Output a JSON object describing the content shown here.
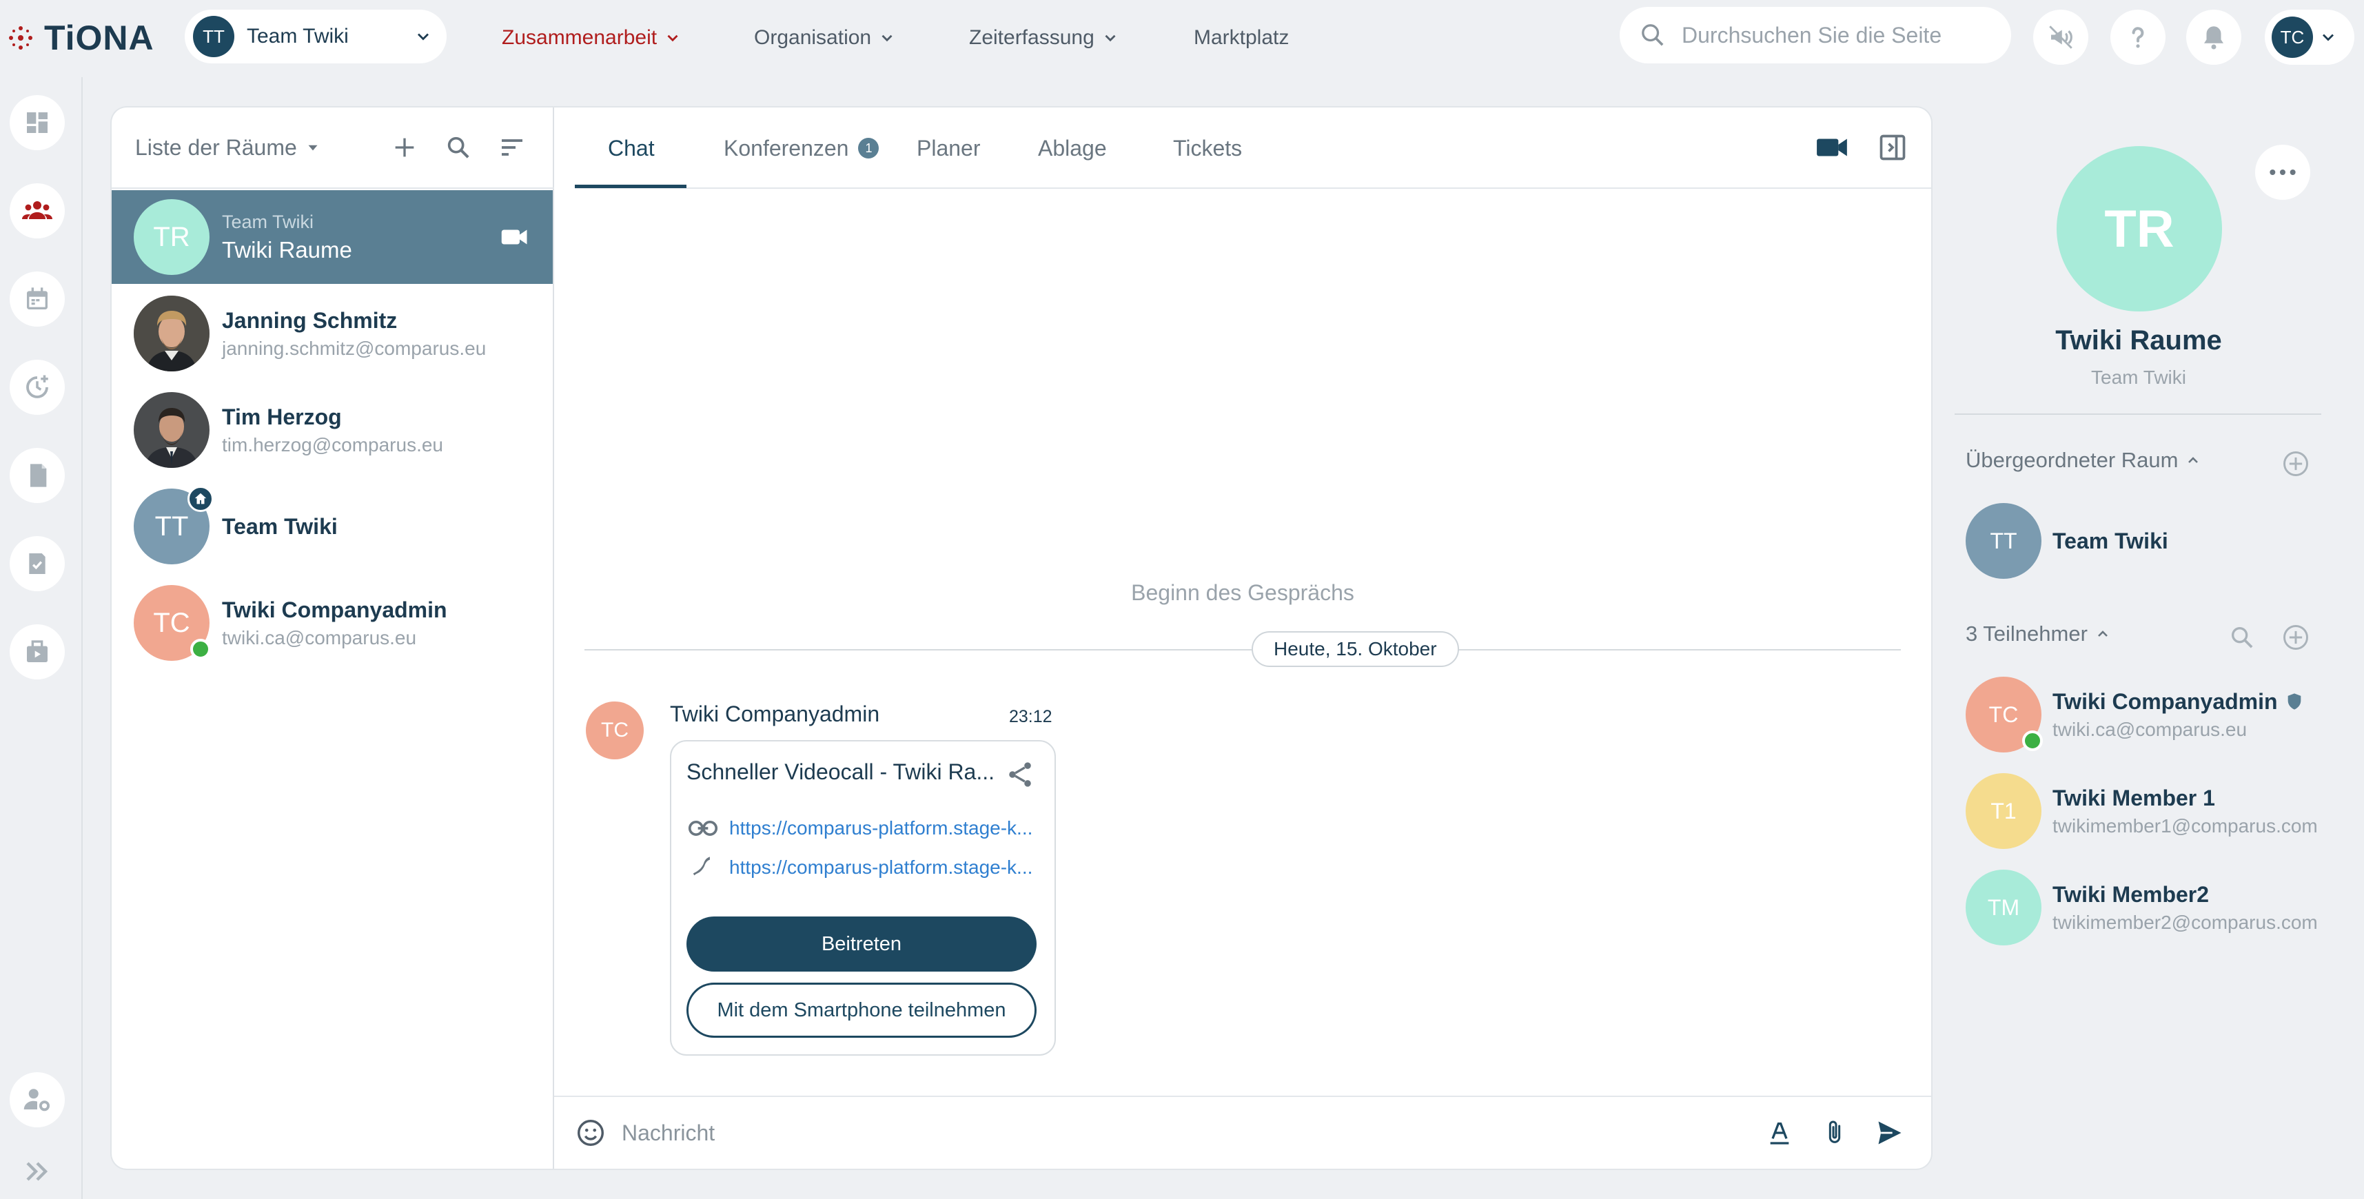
{
  "app": {
    "logo_text": "TiONA"
  },
  "topbar": {
    "team_select": {
      "initials": "TT",
      "label": "Team Twiki"
    },
    "nav": [
      {
        "label": "Zusammenarbeit",
        "active": true
      },
      {
        "label": "Organisation"
      },
      {
        "label": "Zeiterfassung"
      },
      {
        "label": "Marktplatz"
      }
    ],
    "search": {
      "placeholder": "Durchsuchen Sie die Seite"
    },
    "user_initials": "TC"
  },
  "rail": {
    "items": [
      "dashboard-icon",
      "team-icon",
      "calendar-icon",
      "time-add-icon",
      "notes-icon",
      "task-check-icon",
      "briefcase-icon"
    ],
    "bottom": [
      "user-settings-icon",
      "expand-icon"
    ]
  },
  "room_list": {
    "title": "Liste der Räume",
    "rooms": [
      {
        "initials": "TR",
        "name": "Twiki Raume",
        "sub": "Team Twiki",
        "color": "#a8ebd9",
        "selected": true
      },
      {
        "name": "Janning Schmitz",
        "sub": "janning.schmitz@comparus.eu",
        "photo": true
      },
      {
        "name": "Tim Herzog",
        "sub": "tim.herzog@comparus.eu",
        "photo": true
      },
      {
        "initials": "TT",
        "name": "Team Twiki",
        "color": "#7b9bb0"
      },
      {
        "initials": "TC",
        "name": "Twiki Companyadmin",
        "sub": "twiki.ca@comparus.eu",
        "color": "#f1a790",
        "online": true
      }
    ]
  },
  "chat": {
    "tabs": [
      {
        "label": "Chat",
        "active": true
      },
      {
        "label": "Konferenzen",
        "badge": "1"
      },
      {
        "label": "Planer"
      },
      {
        "label": "Ablage"
      },
      {
        "label": "Tickets"
      }
    ],
    "begin_text": "Beginn des Gesprächs",
    "date_label": "Heute, 15. Oktober",
    "message": {
      "initials": "TC",
      "author": "Twiki Companyadmin",
      "time": "23:12",
      "card": {
        "title": "Schneller Videocall - Twiki Ra...",
        "link": "https://comparus-platform.stage-k...",
        "phone_link": "https://comparus-platform.stage-k...",
        "join_label": "Beitreten",
        "phone_label": "Mit dem Smartphone teilnehmen"
      }
    },
    "composer": {
      "placeholder": "Nachricht"
    }
  },
  "details": {
    "initials": "TR",
    "name": "Twiki Raume",
    "sub": "Team Twiki",
    "parent_section": "Übergeordneter Raum",
    "parent": {
      "initials": "TT",
      "name": "Team Twiki"
    },
    "members_section": "3 Teilnehmer",
    "members": [
      {
        "initials": "TC",
        "name": "Twiki Companyadmin",
        "sub": "twiki.ca@comparus.eu",
        "color": "#f1a790",
        "online": true,
        "admin": true
      },
      {
        "initials": "T1",
        "name": "Twiki Member 1",
        "sub": "twikimember1@comparus.com",
        "color": "#f5dc8e"
      },
      {
        "initials": "TM",
        "name": "Twiki Member2",
        "sub": "twikimember2@comparus.com",
        "color": "#a8ebd9"
      }
    ]
  },
  "colors": {
    "primary": "#1d4860",
    "accent_red": "#b01d1d",
    "selected_row": "#5a7f93",
    "online": "#3cb043"
  }
}
